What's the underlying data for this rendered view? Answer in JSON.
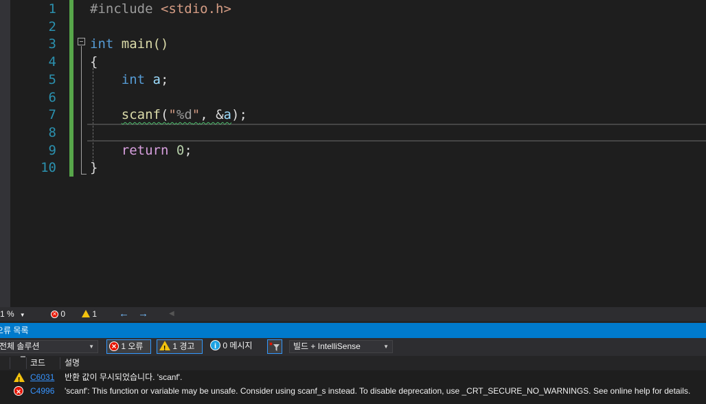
{
  "editor": {
    "line_numbers": [
      "1",
      "2",
      "3",
      "4",
      "5",
      "6",
      "7",
      "8",
      "9",
      "10"
    ],
    "lines": {
      "l1_directive": "#include",
      "l1_header": "<stdio.h>",
      "l3_type": "int",
      "l3_name": "main()",
      "l4_brace": "{",
      "l5_type": "int",
      "l5_var": "a",
      "l5_semi": ";",
      "l7_fn": "scanf",
      "l7_open": "(",
      "l7_str_q1": "\"",
      "l7_fmt": "%d",
      "l7_str_q2": "\"",
      "l7_comma": ", &",
      "l7_var": "a",
      "l7_close": ");",
      "l9_kw": "return",
      "l9_num": "0",
      "l9_semi": ";",
      "l10_brace": "}"
    }
  },
  "status_strip": {
    "zoom": "1 %",
    "error_count": "0",
    "warning_count": "1",
    "back_arrow": "←",
    "forward_arrow": "→"
  },
  "error_list": {
    "title": "오류 목록",
    "scope": "전체 솔루션",
    "errors_button": "1 오류",
    "warnings_button": "1 경고",
    "messages_button": "0 메시지",
    "source_filter": "빌드 + IntelliSense",
    "columns": {
      "code": "코드",
      "description": "설명"
    },
    "rows": [
      {
        "severity": "warning",
        "code": "C6031",
        "description": "반환 값이 무시되었습니다. 'scanf'."
      },
      {
        "severity": "error",
        "code": "C4996",
        "description": "'scanf': This function or variable may be unsafe. Consider using scanf_s instead. To disable deprecation, use _CRT_SECURE_NO_WARNINGS. See online help for details."
      }
    ]
  },
  "colors": {
    "background": "#1e1e1e",
    "keyword": "#569cd6",
    "function": "#dcdcaa",
    "variable": "#9cdcfe",
    "string": "#d69d85",
    "line_number": "#2b91af",
    "change_bar": "#57a64a",
    "accent": "#007acc",
    "link": "#3794ff"
  }
}
